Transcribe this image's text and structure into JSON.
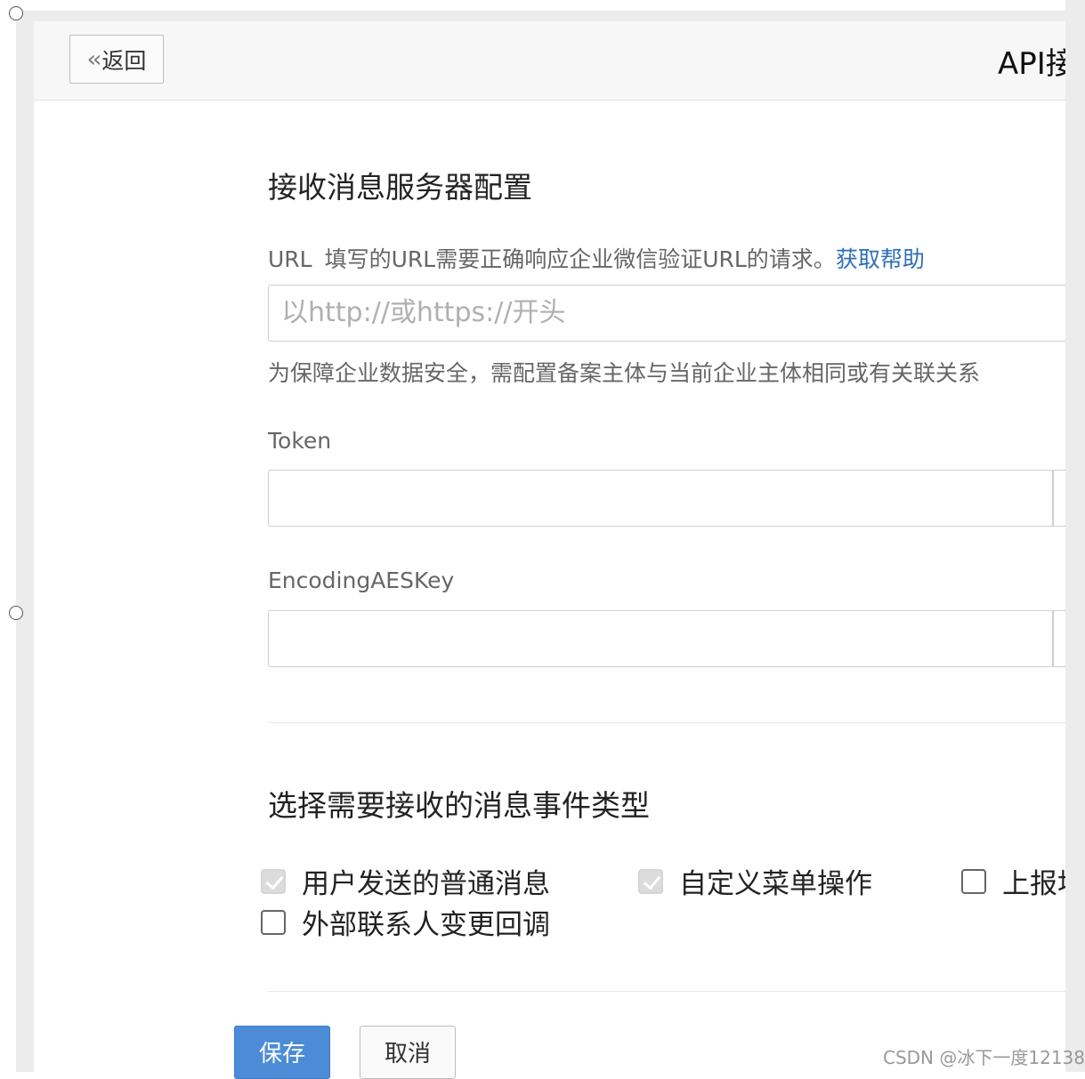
{
  "header": {
    "back_label": "返回",
    "title": "API接"
  },
  "receive_section": {
    "title": "接收消息服务器配置",
    "url": {
      "label": "URL",
      "description": "填写的URL需要正确响应企业微信验证URL的请求。",
      "help_link": "获取帮助",
      "placeholder": "以http://或https://开头",
      "value": "",
      "note": "为保障企业数据安全，需配置备案主体与当前企业主体相同或有关联关系"
    },
    "token": {
      "label": "Token",
      "value": ""
    },
    "aes_key": {
      "label": "EncodingAESKey",
      "value": ""
    }
  },
  "events_section": {
    "title": "选择需要接收的消息事件类型",
    "options": [
      {
        "label": "用户发送的普通消息",
        "checked": true,
        "disabled": true
      },
      {
        "label": "自定义菜单操作",
        "checked": true,
        "disabled": true
      },
      {
        "label": "上报地",
        "checked": false,
        "disabled": false
      },
      {
        "label": "外部联系人变更回调",
        "checked": false,
        "disabled": false
      }
    ]
  },
  "actions": {
    "save_label": "保存",
    "cancel_label": "取消"
  },
  "watermark": "CSDN @冰下一度12138",
  "colors": {
    "link": "#2f6fb5",
    "primary_button": "#4c8cd6",
    "header_bg": "#f7f7f7"
  }
}
